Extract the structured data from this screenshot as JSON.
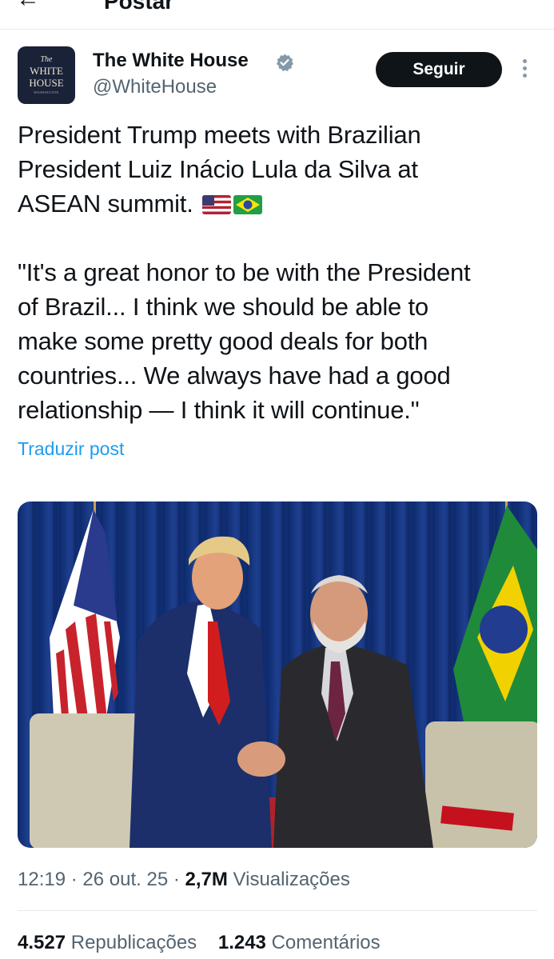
{
  "header": {
    "title": "Postar",
    "back_icon": "arrow-left-icon"
  },
  "author": {
    "avatar_lines": [
      "The",
      "WHITE",
      "HOUSE",
      "WASHINGTON"
    ],
    "name": "The White House",
    "handle": "@WhiteHouse",
    "verified_icon": "verified-badge-icon",
    "verified_color": "#829aab"
  },
  "actions": {
    "follow_label": "Seguir",
    "more_icon": "more-vertical-icon"
  },
  "post": {
    "line1": "President Trump meets with Brazilian",
    "line2": "President Luiz Inácio Lula da Silva at",
    "line3": "ASEAN summit.",
    "flags": [
      "us-flag-icon",
      "brazil-flag-icon"
    ],
    "quote_lines": [
      "\"It's a great honor to be with the President",
      "of Brazil... I think we should be able to",
      "make some pretty good deals for both",
      "countries... We always have had a good",
      "relationship — I think it will continue.\""
    ],
    "translate_label": "Traduzir post",
    "translate_color": "#1d9bf0"
  },
  "meta": {
    "time": "12:19",
    "date": "26 out. 25",
    "views_count": "2,7M",
    "views_label": "Visualizações"
  },
  "stats": {
    "reposts_count": "4.527",
    "reposts_label": "Republicações",
    "comments_count": "1.243",
    "comments_label": "Comentários"
  }
}
